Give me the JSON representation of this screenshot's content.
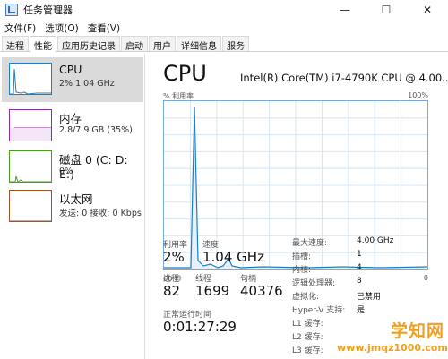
{
  "window": {
    "title": "任务管理器",
    "min_glyph": "—",
    "max_glyph": "☐",
    "close_glyph": "✕"
  },
  "menu": {
    "items": [
      "文件(F)",
      "选项(O)",
      "查看(V)"
    ]
  },
  "tabs": {
    "items": [
      "进程",
      "性能",
      "应用历史记录",
      "启动",
      "用户",
      "详细信息",
      "服务"
    ],
    "active_index": 1
  },
  "sidebar": {
    "items": [
      {
        "title": "CPU",
        "sub": "2% 1.04 GHz",
        "color": "#1a7fc4"
      },
      {
        "title": "内存",
        "sub": "2.8/7.9 GB (35%)",
        "color": "#8b2fa0"
      },
      {
        "title": "磁盘 0 (C: D: E:)",
        "sub": "0%",
        "color": "#4a9e1f"
      },
      {
        "title": "以太网",
        "sub": "发送: 0 接收: 0 Kbps",
        "color": "#a0522d"
      }
    ]
  },
  "main": {
    "title": "CPU",
    "model": "Intel(R) Core(TM) i7-4790K CPU @ 4.00...",
    "graph": {
      "util_label": "% 利用率",
      "max_label": "100%",
      "time_label": "60 秒",
      "min_label": "0"
    },
    "stats": {
      "util_label": "利用率",
      "util_value": "2%",
      "speed_label": "速度",
      "speed_value": "1.04 GHz",
      "proc_label": "进程",
      "proc_value": "82",
      "thread_label": "线程",
      "thread_value": "1699",
      "handle_label": "句柄",
      "handle_value": "40376",
      "uptime_label": "正常运行时间",
      "uptime_value": "0:01:27:29"
    },
    "specs": [
      {
        "key": "最大速度:",
        "value": "4.00 GHz"
      },
      {
        "key": "插槽:",
        "value": "1"
      },
      {
        "key": "内核:",
        "value": "4"
      },
      {
        "key": "逻辑处理器:",
        "value": "8"
      },
      {
        "key": "虚拟化:",
        "value": "已禁用"
      },
      {
        "key": "Hyper-V 支持:",
        "value": "是"
      },
      {
        "key": "L1 缓存:",
        "value": ""
      },
      {
        "key": "L2 缓存:",
        "value": ""
      },
      {
        "key": "L3 缓存:",
        "value": ""
      }
    ]
  },
  "watermark": {
    "cn": "学知网",
    "url": "www.jmqz1000.com"
  },
  "colors": {
    "cpu_line": "#1a7fc4",
    "graph_border": "#7aa8d8",
    "grid": "#d6e6f4"
  }
}
